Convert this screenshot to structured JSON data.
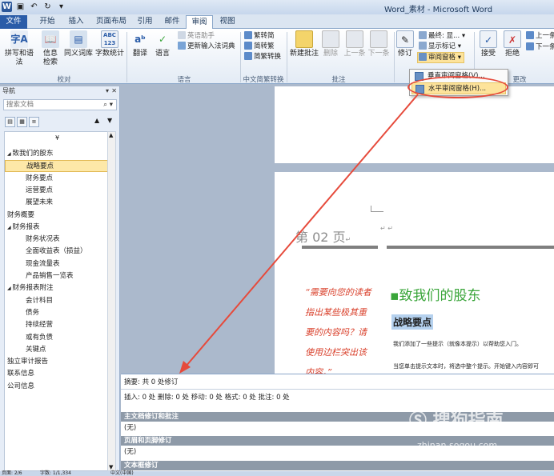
{
  "window": {
    "title": "Word_素材 - Microsoft Word"
  },
  "quick_access": {
    "icons": [
      "word-logo",
      "save-icon",
      "undo-icon",
      "redo-icon",
      "customize-icon"
    ]
  },
  "tabs": [
    "文件",
    "开始",
    "插入",
    "页面布局",
    "引用",
    "邮件",
    "审阅",
    "视图"
  ],
  "active_tab": "审阅",
  "ribbon": {
    "proofing": {
      "group_label": "校对",
      "spelling": "拼写和语法",
      "info_search": "信息检索",
      "thesaurus": "同义词库",
      "word_count": "字数统计"
    },
    "language": {
      "group_label": "语言",
      "translate": "翻译",
      "language": "语言",
      "english_assistant": "英语助手",
      "update_ime": "更新输入法词典"
    },
    "chinese": {
      "group_label": "中文简繁转换",
      "to_simplified": "繁转简",
      "to_traditional": "简转繁",
      "convert": "简繁转换"
    },
    "comments": {
      "group_label": "批注",
      "new": "新建批注",
      "delete": "删除",
      "prev": "上一条",
      "next": "下一条"
    },
    "tracking": {
      "track_changes": "修订",
      "final_display": "最终: 显...",
      "show_markup": "显示标记",
      "reviewing_pane": "审阅窗格"
    },
    "changes": {
      "group_label": "更改",
      "accept": "接受",
      "reject": "拒绝",
      "prev": "上一条",
      "next": "下一条"
    }
  },
  "dropdown": {
    "vertical": "垂直审阅窗格(V)...",
    "horizontal": "水平审阅窗格(H)..."
  },
  "nav": {
    "title": "导航",
    "search_placeholder": "搜索文档",
    "collapse": "¥",
    "items": [
      {
        "label": "致我们的股东",
        "level": 0,
        "expand": "◢"
      },
      {
        "label": "战略要点",
        "level": 1,
        "selected": true
      },
      {
        "label": "财务要点",
        "level": 1
      },
      {
        "label": "运营要点",
        "level": 1
      },
      {
        "label": "展望未来",
        "level": 1
      },
      {
        "label": "财务概要",
        "level": 0
      },
      {
        "label": "财务报表",
        "level": 0,
        "expand": "◢"
      },
      {
        "label": "财务状况表",
        "level": 1
      },
      {
        "label": "全面收益表（损益）",
        "level": 1
      },
      {
        "label": "现金流量表",
        "level": 1
      },
      {
        "label": "产品销售一览表",
        "level": 1
      },
      {
        "label": "财务报表附注",
        "level": 0,
        "expand": "◢"
      },
      {
        "label": "会计科目",
        "level": 1
      },
      {
        "label": "债务",
        "level": 1
      },
      {
        "label": "持续经营",
        "level": 1
      },
      {
        "label": "或有负债",
        "level": 1
      },
      {
        "label": "关键点",
        "level": 1
      },
      {
        "label": "独立审计报告",
        "level": 0
      },
      {
        "label": "联系信息",
        "level": 0
      },
      {
        "label": "公司信息",
        "level": 0
      }
    ]
  },
  "document": {
    "page_label": "第 02 页",
    "sidebar_quote": [
      "“需要向您的读者",
      "指出某些极其重",
      "要的内容吗？请",
      "使用边栏突出该",
      "内容。”"
    ],
    "heading1": "致我们的股东",
    "heading2": "战略要点",
    "body1": "我们添加了一些提示（就像本提示）以帮助您入门。",
    "body2": "当您单击提示文本时，将选中整个提示。开始键入内容即可"
  },
  "review_pane": {
    "summary": "摘要: 共 0 处修订",
    "detail": "插入: 0 处  删除: 0 处  移动: 0 处  格式: 0 处  批注: 0 处",
    "sections": [
      {
        "title": "主文档修订和批注",
        "value": "(无)"
      },
      {
        "title": "页眉和页脚修订",
        "value": "(无)"
      },
      {
        "title": "文本框修订",
        "value": ""
      }
    ]
  },
  "status_bar": {
    "page": "页面: 2/6",
    "words": "字数: 1/1,334",
    "language": "中文(中国)"
  },
  "watermark": {
    "brand": "搜狗指南",
    "url": "zhinan.sogou.com"
  },
  "colors": {
    "accent": "#2a5ca8",
    "callout": "#e64a3b",
    "heading_green": "#3aa53a",
    "quote_red": "#d9402b"
  }
}
